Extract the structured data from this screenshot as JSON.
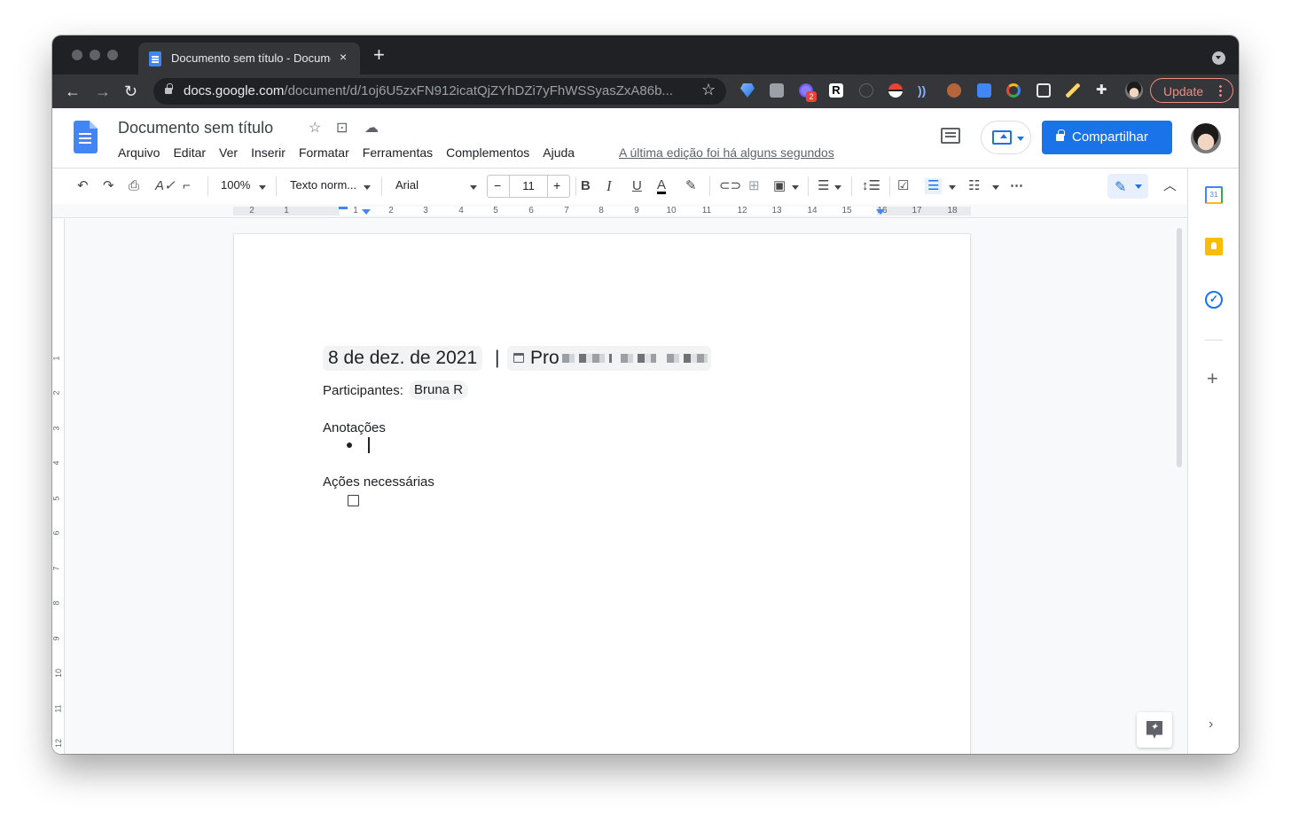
{
  "browser": {
    "tab_title": "Documento sem título - Documentos Google",
    "tab_close": "×",
    "new_tab": "+",
    "url_domain": "docs.google.com",
    "url_path": "/document/d/1oj6U5zxFN912icatQjZYhDZi7yFhWSSyasZxA86b...",
    "update_label": "Update",
    "extension_badge": "2"
  },
  "docs": {
    "title": "Documento sem título",
    "menu": [
      "Arquivo",
      "Editar",
      "Ver",
      "Inserir",
      "Formatar",
      "Ferramentas",
      "Complementos",
      "Ajuda"
    ],
    "last_edit": "A última edição foi há alguns segundos",
    "share_label": "Compartilhar"
  },
  "toolbar": {
    "zoom": "100%",
    "style": "Texto norm...",
    "font": "Arial",
    "font_size": "11",
    "minus": "−",
    "plus": "+"
  },
  "ruler": {
    "numbers": [
      "2",
      "1",
      "1",
      "2",
      "3",
      "4",
      "5",
      "6",
      "7",
      "8",
      "9",
      "10",
      "11",
      "12",
      "13",
      "14",
      "15",
      "16",
      "17",
      "18"
    ],
    "vnumbers": [
      "1",
      "2",
      "3",
      "4",
      "5",
      "6",
      "7",
      "8",
      "9",
      "10",
      "11",
      "12"
    ]
  },
  "document": {
    "date_chip": "8 de dez. de 2021",
    "separator": "|",
    "event_chip_visible": "Pro",
    "participants_label": "Participantes:",
    "participant_chip": "Bruna R",
    "notes_heading": "Anotações",
    "actions_heading": "Ações necessárias"
  },
  "colors": {
    "accent": "#1a73e8",
    "chrome_dark": "#202124",
    "update": "#f28b82"
  }
}
